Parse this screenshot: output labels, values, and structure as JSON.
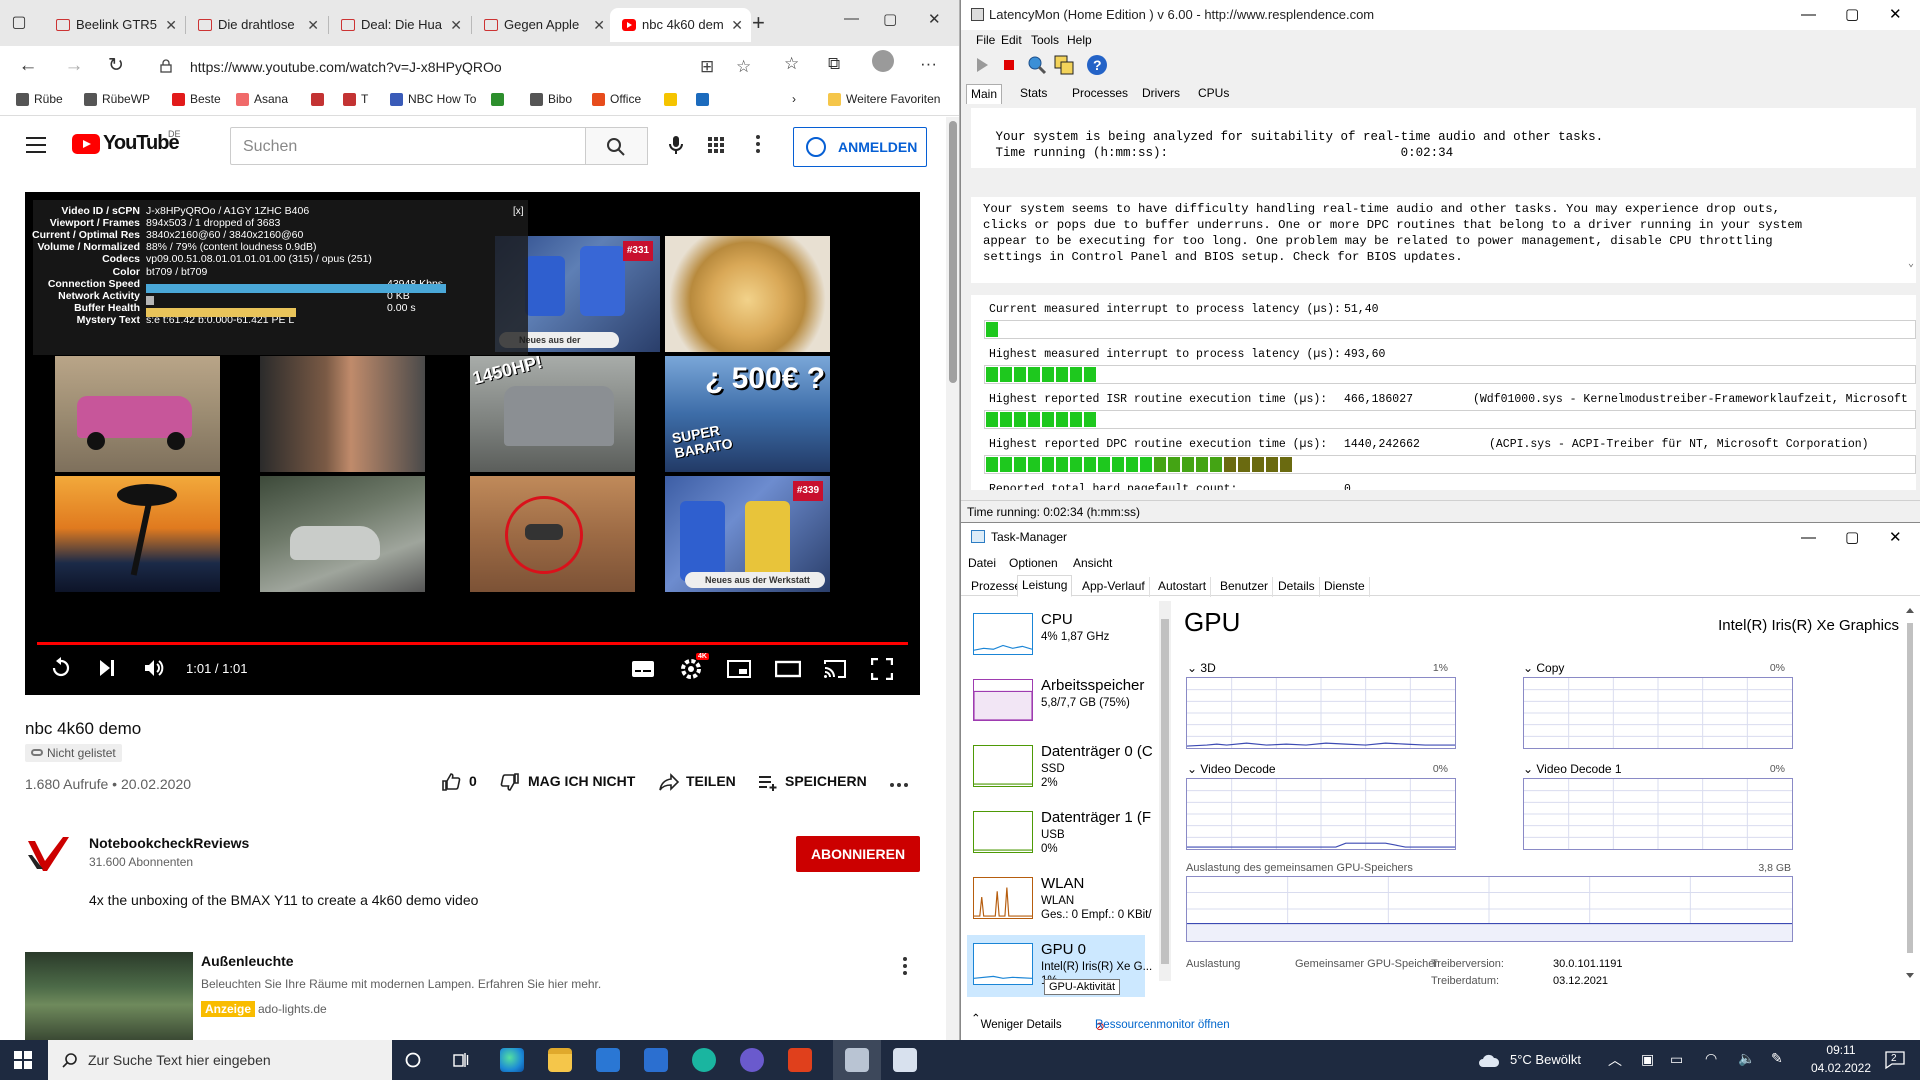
{
  "edge": {
    "tabs": [
      {
        "label": "Beelink GTR5"
      },
      {
        "label": "Die drahtlose"
      },
      {
        "label": "Deal: Die Hua"
      },
      {
        "label": "Gegen Apple"
      },
      {
        "label": "nbc 4k60 dem"
      }
    ],
    "url": "https://www.youtube.com/watch?v=J-x8HPyQROo",
    "favorites": [
      {
        "label": "Rübe",
        "color": "#555555"
      },
      {
        "label": "RübeWP",
        "color": "#555555"
      },
      {
        "label": "Beste",
        "color": "#e21b1b"
      },
      {
        "label": "Asana",
        "color": "#f06a6a"
      },
      {
        "label": "",
        "color": "#c33333"
      },
      {
        "label": "T",
        "color": "#c33333"
      },
      {
        "label": "NBC How To",
        "color": "#3a5bb8"
      },
      {
        "label": "",
        "color": "#2d8f2d"
      },
      {
        "label": "Bibo",
        "color": "#555555"
      },
      {
        "label": "Office",
        "color": "#e74c1c"
      },
      {
        "label": "",
        "color": "#f5c400"
      },
      {
        "label": "",
        "color": "#1c6bbd"
      }
    ],
    "other_favorites": "Weitere Favoriten"
  },
  "youtube": {
    "logo": "YouTube",
    "region": "DE",
    "search_placeholder": "Suchen",
    "signin": "ANMELDEN",
    "player": {
      "time": "1:01 / 1:01",
      "stats": [
        {
          "k": "Video ID / sCPN",
          "v": "J-x8HPyQROo / A1GY 1ZHC B406"
        },
        {
          "k": "Viewport / Frames",
          "v": "894x503 / 1 dropped of 3683"
        },
        {
          "k": "Current / Optimal Res",
          "v": "3840x2160@60 / 3840x2160@60"
        },
        {
          "k": "Volume / Normalized",
          "v": "88% / 79% (content loudness 0.9dB)"
        },
        {
          "k": "Codecs",
          "v": "vp09.00.51.08.01.01.01.01.00 (315) / opus (251)"
        },
        {
          "k": "Color",
          "v": "bt709 / bt709"
        },
        {
          "k": "Connection Speed",
          "v": "43948 Kbps"
        },
        {
          "k": "Network Activity",
          "v": "0 KB"
        },
        {
          "k": "Buffer Health",
          "v": "0.00 s"
        },
        {
          "k": "Mystery Text",
          "v": "s:e t:61.42 b:0.000-61.421 PE L"
        }
      ],
      "stats_close": "[x]",
      "thumb_labels": {
        "ep331": "#331",
        "werkstatt": "Neues aus der Werkstatt",
        "hp": "1450HP!",
        "price": "¿ 500€ ?",
        "super": "SUPER BARATO",
        "ep339": "#339",
        "werkstatt2": "Neues aus der Werkstatt"
      },
      "quality_badge": "4K"
    },
    "video": {
      "title": "nbc 4k60 demo",
      "unlisted": "Nicht gelistet",
      "meta": "1.680 Aufrufe • 20.02.2020",
      "likes": "0",
      "dislike": "MAG ICH NICHT",
      "share": "TEILEN",
      "save": "SPEICHERN"
    },
    "channel": {
      "name": "NotebookcheckReviews",
      "subs": "31.600 Abonnenten",
      "subscribe": "ABONNIEREN"
    },
    "description": "4x the unboxing of the BMAX Y11 to create a 4k60 demo video",
    "ad": {
      "title": "Außenleuchte",
      "desc": "Beleuchten Sie Ihre Räume mit modernen Lampen. Erfahren Sie hier mehr.",
      "badge": "Anzeige",
      "domain": "ado-lights.de"
    }
  },
  "latencymon": {
    "title": "LatencyMon  (Home Edition )  v 6.00 - http://www.resplendence.com",
    "menu": [
      "File",
      "Edit",
      "Tools",
      "Help"
    ],
    "tabs": [
      "Main",
      "Stats",
      "Processes",
      "Drivers",
      "CPUs"
    ],
    "analysis": [
      " Your system is being analyzed for suitability of real-time audio and other tasks.",
      " Time running (h:mm:ss):                               0:02:34"
    ],
    "message": [
      "Your system seems to have difficulty handling real-time audio and other tasks. You may experience drop outs,",
      "clicks or pops due to buffer underruns. One or more DPC routines that belong to a driver running in your system",
      "appear to be executing for too long. One problem may be related to power management, disable CPU throttling",
      "settings in Control Panel and BIOS setup. Check for BIOS updates."
    ],
    "metrics": [
      {
        "label": "Current measured interrupt to process latency (µs):",
        "value": "51,40",
        "extra": "",
        "segments": 1
      },
      {
        "label": "Highest measured interrupt to process latency (µs):",
        "value": "493,60",
        "extra": "",
        "segments": 8
      },
      {
        "label": "Highest reported ISR routine execution time (µs):",
        "value": "466,186027",
        "extra": "(Wdf01000.sys - Kernelmodustreiber-Frameworklaufzeit, Microsoft",
        "segments": 8
      },
      {
        "label": "Highest reported DPC routine execution time (µs):",
        "value": "1440,242662",
        "extra": "(ACPI.sys - ACPI-Treiber für NT, Microsoft Corporation)",
        "segments": 22
      },
      {
        "label": "Reported total hard pagefault count:",
        "value": "0",
        "extra": "",
        "segments": 0
      }
    ],
    "status": "Time running: 0:02:34  (h:mm:ss)"
  },
  "taskmanager": {
    "title": "Task-Manager",
    "menu": [
      "Datei",
      "Optionen",
      "Ansicht"
    ],
    "tabs": [
      "Prozesse",
      "Leistung",
      "App-Verlauf",
      "Autostart",
      "Benutzer",
      "Details",
      "Dienste"
    ],
    "sidebar": [
      {
        "name": "CPU",
        "s1": "4% 1,87 GHz",
        "s2": "",
        "color": "#1a85d6"
      },
      {
        "name": "Arbeitsspeicher",
        "s1": "5,8/7,7 GB (75%)",
        "s2": "",
        "color": "#9e3bb0"
      },
      {
        "name": "Datenträger 0 (C",
        "s1": "SSD",
        "s2": "2%",
        "color": "#4e9a06"
      },
      {
        "name": "Datenträger 1 (F",
        "s1": "USB",
        "s2": "0%",
        "color": "#4e9a06"
      },
      {
        "name": "WLAN",
        "s1": "WLAN",
        "s2": "Ges.: 0 Empf.: 0 KBit/",
        "color": "#b65d0e"
      },
      {
        "name": "GPU 0",
        "s1": "Intel(R) Iris(R) Xe G...",
        "s2": "1%",
        "color": "#1a85d6"
      }
    ],
    "gpu_heading": "GPU",
    "gpu_name": "Intel(R) Iris(R) Xe Graphics",
    "engines": [
      {
        "label": "3D",
        "pct": "1%"
      },
      {
        "label": "Copy",
        "pct": "0%"
      },
      {
        "label": "Video Decode",
        "pct": "0%"
      },
      {
        "label": "Video Decode 1",
        "pct": "0%"
      }
    ],
    "shared_label": "Auslastung des gemeinsamen GPU-Speichers",
    "shared_max": "3,8 GB",
    "stats": {
      "util_label": "Auslastung",
      "shared_mem_label": "Gemeinsamer GPU-Speicher",
      "driver_ver_label": "Treiberversion:",
      "driver_ver": "30.0.101.1191",
      "driver_date_label": "Treiberdatum:",
      "driver_date": "03.12.2021"
    },
    "tooltip": "GPU-Aktivität",
    "fewer": "Weniger Details",
    "resmon": "Ressourcenmonitor öffnen"
  },
  "taskbar": {
    "search": "Zur Suche Text hier eingeben",
    "weather": "5°C  Bewölkt",
    "time": "09:11",
    "date": "04.02.2022",
    "notifications": "2"
  }
}
